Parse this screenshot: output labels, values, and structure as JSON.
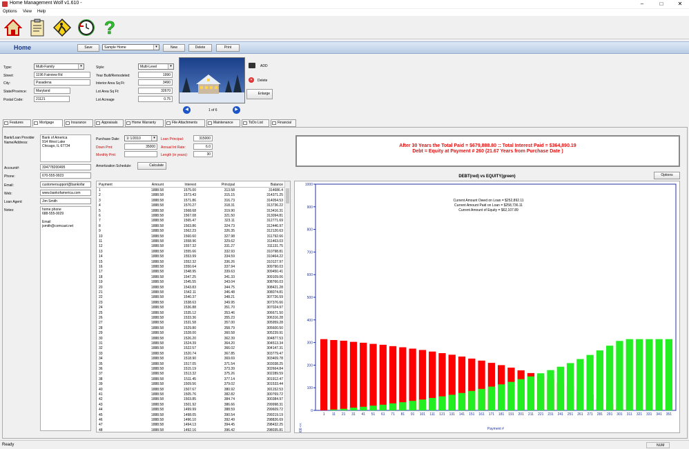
{
  "app": {
    "title": "Home Management Wolf v1.610 -"
  },
  "menu": {
    "options": "Options",
    "view": "View",
    "help": "Help"
  },
  "toolbar_icons": [
    "house-icon",
    "clipboard-icon",
    "worker-sign-icon",
    "clock-arrow-icon",
    "question-icon"
  ],
  "header": {
    "title": "Home",
    "save": "Save",
    "home_select": "Sample Home",
    "new": "New",
    "delete": "Delete",
    "print": "Print"
  },
  "property": {
    "type_label": "Type:",
    "type": "Multi-Family",
    "street_label": "Street:",
    "street": "1196 Fairview Rd",
    "city_label": "City:",
    "city": "Pasadena",
    "state_label": "State/Province:",
    "state": "Maryland",
    "postal_label": "Postal Code:",
    "postal": "21121",
    "style_label": "Style:",
    "style": "Multi-Level",
    "year_label": "Year Built/Remodeled:",
    "year": "1990",
    "area_label": "Interior Area Sq Ft:",
    "area": "3490",
    "lot_label": "Lot Area Sq Ft:",
    "lot": "32670",
    "acreage_label": "Lot Acreage",
    "acreage": "0.75"
  },
  "photo": {
    "add": "ADD",
    "delete": "Delete",
    "enlarge": "Enlarge",
    "counter": "1 of 6"
  },
  "tabs": [
    "Features",
    "Mortgage",
    "Insurance",
    "Appraisals",
    "Home Warranty",
    "File Attachments",
    "Maintenance",
    "ToDo List",
    "Financial"
  ],
  "mortgage": {
    "bank_label": "Bank/Loan Provider Name/Address:",
    "bank_lines": [
      "Bank of America",
      "914 West Lake",
      "Chicago, IL  67734"
    ],
    "account_label": "Account#:",
    "account": "334778200495",
    "phone_label": "Phone:",
    "phone": "670-555-9923",
    "email_label": "Email:",
    "email": "customersupport@bankofar",
    "web_label": "Web:",
    "web": "www.bankofamerica.com",
    "agent_label": "Loan Agent:",
    "agent": "Jim Smith",
    "notes_label": "Notes:",
    "notes_lines": [
      "home phone",
      "688-555-9029",
      "",
      "Email",
      "jsmith@comcast.net"
    ],
    "purchase_date_label": "Purchase Date:",
    "purchase_date": "1/  1/2010",
    "down_label": "Down Pmt:",
    "down": "35000",
    "monthly_label": "Monthly Pmt:",
    "monthly": "",
    "principal_label": "Loan Principal:",
    "principal": "315000",
    "rate_label": "Annual Int Rate:",
    "rate": "6.0",
    "length_label": "Length (in years):",
    "length": "30",
    "amort_label": "Amortization Schedule:",
    "calculate": "Calculate"
  },
  "summary": {
    "line1": "After 30 Years the Total Paid = $679,888.80 :: Total Interest Paid = $364,890.19",
    "line2": "Debt = Equity at Payment # 260 (21.67 Years from Purchase Date )"
  },
  "table": {
    "headers": [
      "Payment",
      "Amount",
      "Interest",
      "Principal",
      "Balance"
    ],
    "rows": [
      [
        "1",
        "1888.58",
        "1575.00",
        "313.58",
        "314686.4"
      ],
      [
        "2",
        "1888.58",
        "1573.43",
        "315.15",
        "314371.25"
      ],
      [
        "3",
        "1888.58",
        "1571.86",
        "316.73",
        "314054.53"
      ],
      [
        "4",
        "1888.58",
        "1570.27",
        "318.31",
        "313736.22"
      ],
      [
        "5",
        "1888.58",
        "1568.68",
        "319.90",
        "313416.31"
      ],
      [
        "6",
        "1888.58",
        "1567.08",
        "321.50",
        "313094.81"
      ],
      [
        "7",
        "1888.58",
        "1565.47",
        "323.11",
        "312771.69"
      ],
      [
        "8",
        "1888.58",
        "1563.86",
        "324.73",
        "312446.97"
      ],
      [
        "9",
        "1888.58",
        "1562.23",
        "326.35",
        "312120.63"
      ],
      [
        "10",
        "1888.58",
        "1560.60",
        "327.98",
        "311792.66"
      ],
      [
        "11",
        "1888.58",
        "1558.96",
        "329.62",
        "311463.03"
      ],
      [
        "12",
        "1888.58",
        "1557.32",
        "331.27",
        "311131.75"
      ],
      [
        "13",
        "1888.58",
        "1555.66",
        "332.93",
        "310798.81"
      ],
      [
        "14",
        "1888.58",
        "1553.99",
        "334.59",
        "310464.22"
      ],
      [
        "15",
        "1888.58",
        "1552.32",
        "336.26",
        "310127.97"
      ],
      [
        "16",
        "1888.58",
        "1550.64",
        "337.94",
        "309790.03"
      ],
      [
        "17",
        "1888.58",
        "1548.95",
        "339.63",
        "309450.41"
      ],
      [
        "18",
        "1888.58",
        "1547.25",
        "341.33",
        "309109.06"
      ],
      [
        "19",
        "1888.58",
        "1545.55",
        "343.04",
        "308766.03"
      ],
      [
        "20",
        "1888.58",
        "1543.83",
        "344.75",
        "308421.28"
      ],
      [
        "21",
        "1888.58",
        "1542.11",
        "346.48",
        "308074.81"
      ],
      [
        "22",
        "1888.58",
        "1540.37",
        "348.21",
        "307726.59"
      ],
      [
        "23",
        "1888.58",
        "1538.63",
        "349.95",
        "307376.66"
      ],
      [
        "24",
        "1888.58",
        "1536.88",
        "351.70",
        "307024.97"
      ],
      [
        "25",
        "1888.58",
        "1535.12",
        "353.46",
        "306671.50"
      ],
      [
        "26",
        "1888.58",
        "1533.36",
        "355.23",
        "306316.28"
      ],
      [
        "27",
        "1888.58",
        "1531.58",
        "357.00",
        "305959.28"
      ],
      [
        "28",
        "1888.58",
        "1529.80",
        "358.79",
        "305600.50"
      ],
      [
        "29",
        "1888.58",
        "1528.00",
        "360.58",
        "305239.91"
      ],
      [
        "30",
        "1888.58",
        "1526.20",
        "362.39",
        "304877.53"
      ],
      [
        "31",
        "1888.58",
        "1524.39",
        "364.20",
        "304513.34"
      ],
      [
        "32",
        "1888.58",
        "1522.57",
        "366.02",
        "304147.31"
      ],
      [
        "33",
        "1888.58",
        "1520.74",
        "367.85",
        "303779.47"
      ],
      [
        "34",
        "1888.58",
        "1518.90",
        "369.69",
        "303409.78"
      ],
      [
        "35",
        "1888.58",
        "1517.05",
        "371.54",
        "303038.25"
      ],
      [
        "36",
        "1888.58",
        "1515.19",
        "373.39",
        "302664.84"
      ],
      [
        "37",
        "1888.58",
        "1513.32",
        "375.26",
        "302289.59"
      ],
      [
        "38",
        "1888.58",
        "1511.45",
        "377.14",
        "301912.47"
      ],
      [
        "39",
        "1888.58",
        "1509.56",
        "379.02",
        "301533.44"
      ],
      [
        "40",
        "1888.58",
        "1507.67",
        "380.92",
        "301152.53"
      ],
      [
        "41",
        "1888.58",
        "1505.76",
        "382.82",
        "300769.72"
      ],
      [
        "42",
        "1888.58",
        "1503.85",
        "384.74",
        "300384.97"
      ],
      [
        "43",
        "1888.58",
        "1501.92",
        "386.66",
        "299998.31"
      ],
      [
        "44",
        "1888.58",
        "1499.99",
        "388.59",
        "299609.72"
      ],
      [
        "45",
        "1888.58",
        "1498.05",
        "390.54",
        "299219.19"
      ],
      [
        "46",
        "1888.58",
        "1496.10",
        "392.49",
        "298826.69"
      ],
      [
        "47",
        "1888.58",
        "1494.13",
        "394.45",
        "298432.25"
      ],
      [
        "48",
        "1888.58",
        "1492.16",
        "396.42",
        "298035.81"
      ]
    ]
  },
  "chart_data": {
    "type": "bar",
    "title": "DEBT(red) vs EQUITY(green)",
    "xlabel": "Payment #",
    "ylabel": "value x 1000 <<",
    "ylim": [
      0,
      1000
    ],
    "yticks": [
      0,
      100,
      200,
      300,
      400,
      500,
      600,
      700,
      800,
      900,
      1000
    ],
    "x": [
      1,
      11,
      21,
      31,
      41,
      51,
      61,
      71,
      81,
      91,
      101,
      111,
      121,
      131,
      141,
      151,
      161,
      171,
      181,
      191,
      201,
      211,
      221,
      231,
      241,
      251,
      261,
      271,
      281,
      291,
      301,
      311,
      321,
      331,
      341,
      351
    ],
    "series": [
      {
        "name": "DEBT",
        "color": "#ff0000",
        "values": [
          315,
          311,
          308,
          303,
          299,
          294,
          290,
          284,
          279,
          273,
          267,
          260,
          253,
          246,
          238,
          229,
          220,
          210,
          200,
          189,
          177,
          165,
          151,
          137,
          122,
          106,
          88,
          70,
          50,
          29,
          8,
          0,
          0,
          0,
          0,
          0
        ]
      },
      {
        "name": "EQUITY",
        "color": "#22ee22",
        "values": [
          0,
          4,
          7,
          12,
          16,
          21,
          25,
          31,
          36,
          42,
          48,
          55,
          62,
          69,
          77,
          86,
          95,
          105,
          115,
          126,
          138,
          150,
          164,
          178,
          193,
          209,
          227,
          245,
          265,
          286,
          307,
          315,
          315,
          315,
          315,
          315
        ]
      }
    ],
    "annotations": [
      "Current Amount Owed on Loan = $252,892.11",
      "Current Amount Paid on Loan = $258,736.11",
      "Current Amount of Equity = $62,107.89"
    ],
    "options": "Options"
  },
  "status": {
    "ready": "Ready",
    "num": "NUM"
  }
}
